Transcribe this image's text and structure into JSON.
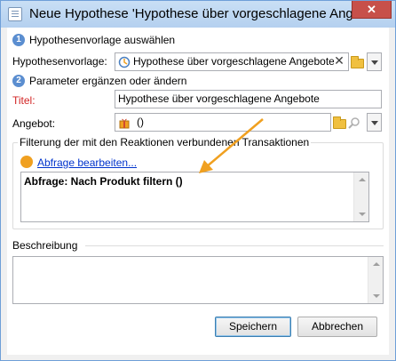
{
  "window": {
    "title": "Neue Hypothese 'Hypothese über vorgeschlagene Angebote'",
    "close_label": "✕"
  },
  "step1": {
    "number": "1",
    "heading": "Hypothesenvorlage auswählen",
    "template_label": "Hypothesenvorlage:",
    "template_value": "Hypothese über vorgeschlagene Angebote"
  },
  "step2": {
    "number": "2",
    "heading": "Parameter ergänzen oder ändern",
    "title_label": "Titel:",
    "title_value": "Hypothese über vorgeschlagene Angebote",
    "offer_label": "Angebot:",
    "offer_value": "()"
  },
  "filter": {
    "group_title": "Filterung der mit den Reaktionen verbundenen Transaktionen",
    "edit_link": "Abfrage bearbeiten...",
    "query_text": "Abfrage: Nach Produkt filtern ()"
  },
  "description": {
    "group_title": "Beschreibung",
    "value": ""
  },
  "buttons": {
    "save": "Speichern",
    "cancel": "Abbrechen"
  },
  "colors": {
    "accent_blue": "#5b8ed0",
    "annotation_orange": "#f0a020",
    "required_red": "#d22424",
    "close_red": "#c7504a"
  }
}
